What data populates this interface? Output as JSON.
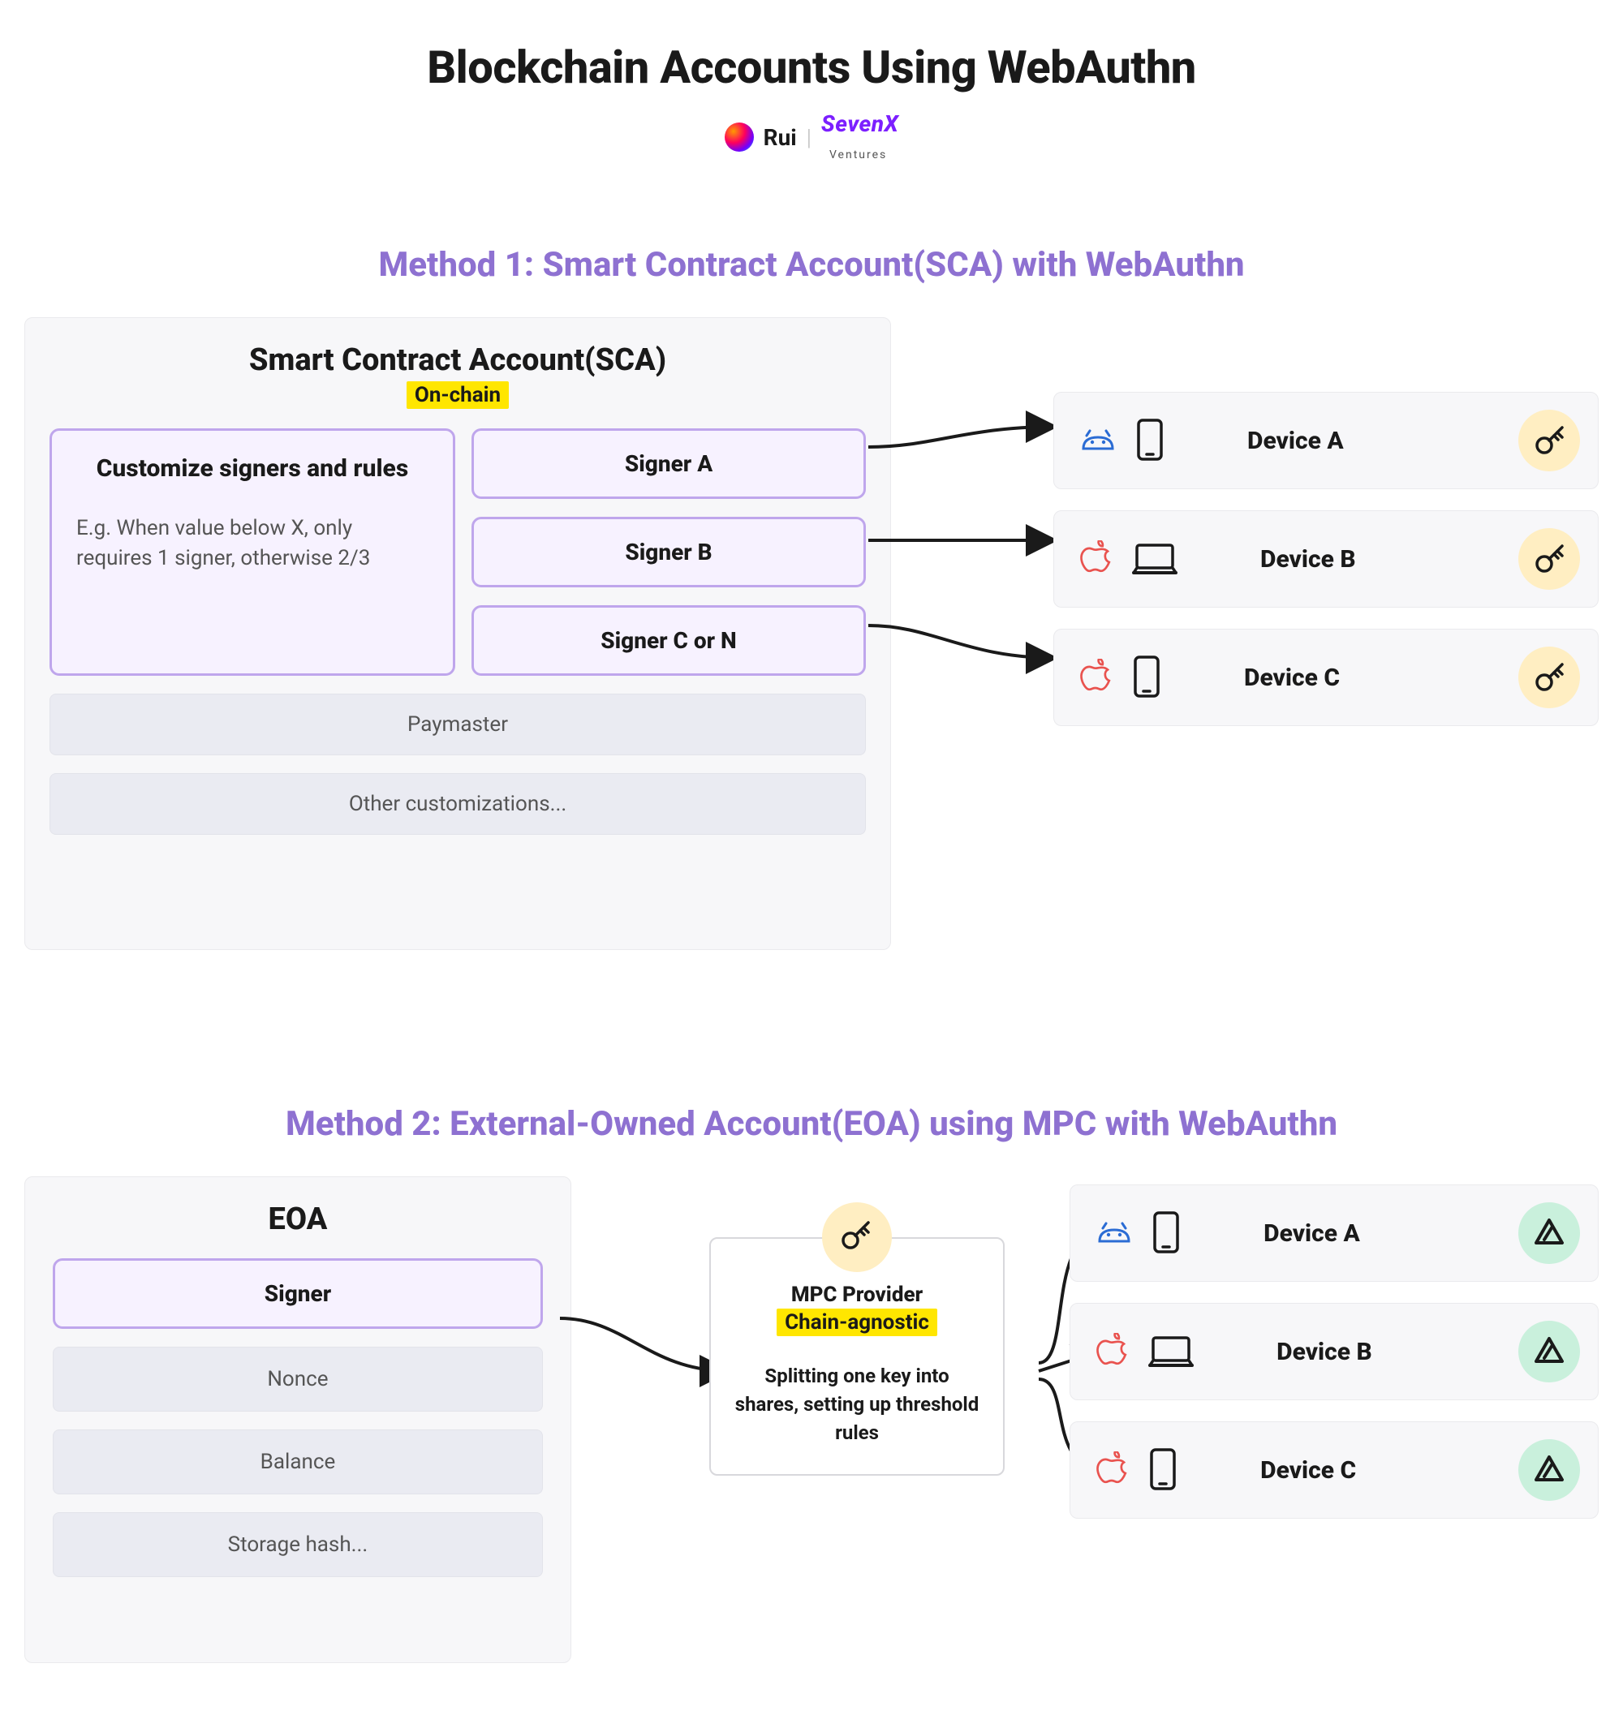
{
  "title": "Blockchain Accounts Using WebAuthn",
  "byline": {
    "author": "Rui",
    "brand": "SevenX",
    "brand_sub": "Ventures"
  },
  "method1": {
    "heading": "Method 1: Smart Contract Account(SCA) with WebAuthn",
    "box_title": "Smart Contract Account(SCA)",
    "box_tag": "On-chain",
    "rules": {
      "title": "Customize signers and rules",
      "example": "E.g. When value below X, only requires 1 signer, otherwise 2/3"
    },
    "signers": [
      "Signer A",
      "Signer B",
      "Signer C or N"
    ],
    "extra": [
      "Paymaster",
      "Other customizations..."
    ],
    "devices": [
      {
        "label": "Device A",
        "os": "android",
        "form": "phone",
        "badge": "key"
      },
      {
        "label": "Device B",
        "os": "apple",
        "form": "laptop",
        "badge": "key"
      },
      {
        "label": "Device C",
        "os": "apple",
        "form": "phone",
        "badge": "key"
      }
    ]
  },
  "method2": {
    "heading": "Method 2: External-Owned Account(EOA) using MPC with WebAuthn",
    "eoa_title": "EOA",
    "signer": "Signer",
    "fields": [
      "Nonce",
      "Balance",
      "Storage hash..."
    ],
    "mpc": {
      "title": "MPC Provider",
      "tag": "Chain-agnostic",
      "desc": "Splitting one key into shares, setting up threshold rules"
    },
    "devices": [
      {
        "label": "Device A",
        "os": "android",
        "form": "phone",
        "badge": "tri"
      },
      {
        "label": "Device B",
        "os": "apple",
        "form": "laptop",
        "badge": "tri"
      },
      {
        "label": "Device C",
        "os": "apple",
        "form": "phone",
        "badge": "tri"
      }
    ]
  }
}
